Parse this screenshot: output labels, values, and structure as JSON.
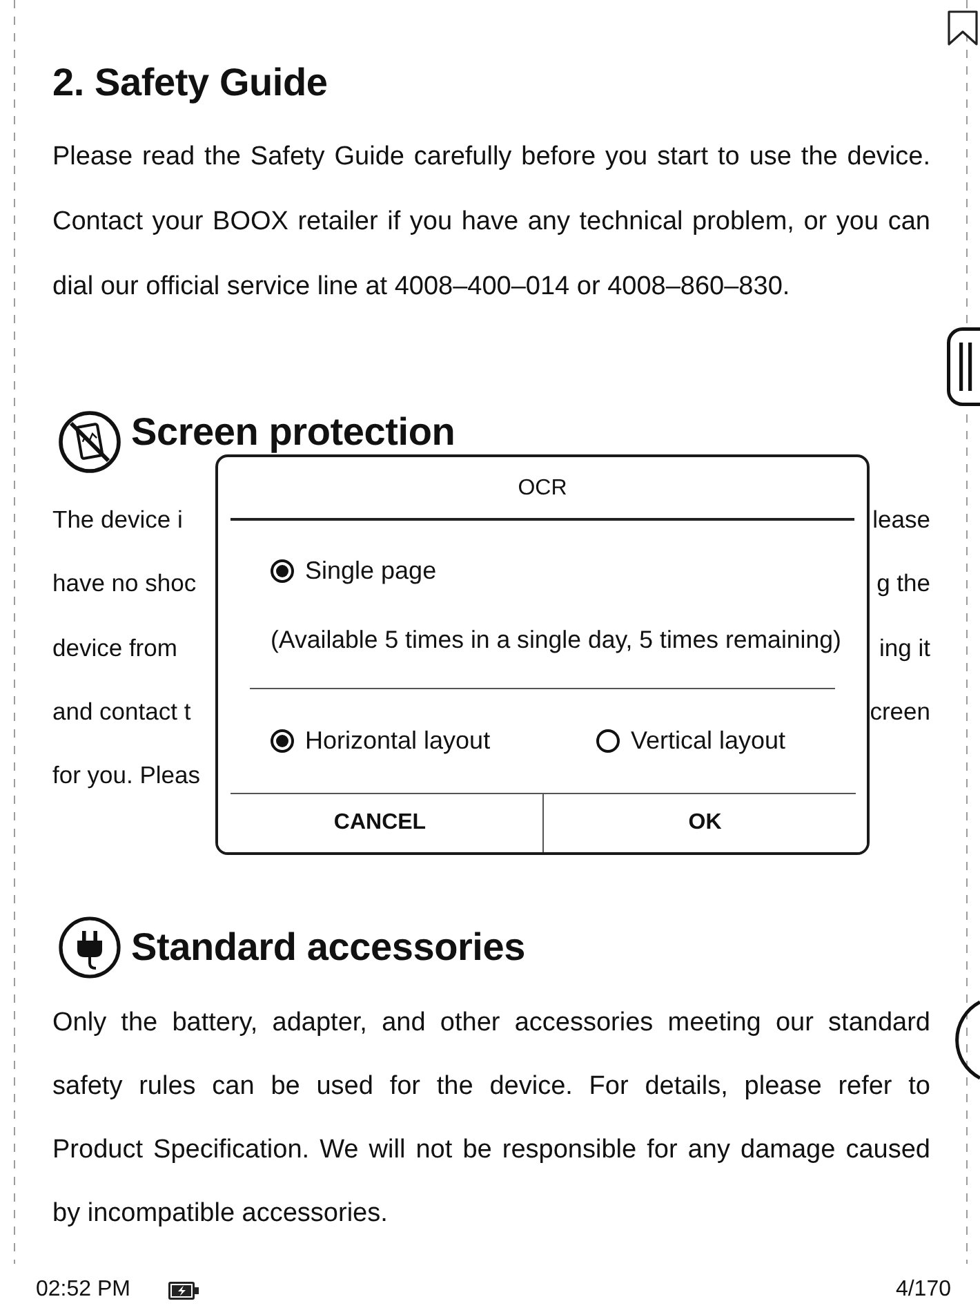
{
  "section": {
    "title": "2. Safety Guide",
    "paragraph": [
      "Please read the Safety Guide carefully before you start to use the device.",
      "Contact your BOOX retailer if you have any technical problem, or you can",
      "dial our official service line at 4008–400–014 or 4008–860–830."
    ]
  },
  "subsections": [
    {
      "heading": "Screen protection",
      "covered_lines": [
        {
          "left": "The device i",
          "right": "lease"
        },
        {
          "left": "have no shoc",
          "right": "g the"
        },
        {
          "left": "device from",
          "right": "ing it"
        },
        {
          "left": "and contact t",
          "right": "creen"
        },
        {
          "left": "for you. Pleas"
        }
      ]
    },
    {
      "heading": "Standard accessories",
      "paragraph": [
        "Only the battery, adapter, and other accessories meeting our standard",
        "safety rules can be used for the device. For details, please refer to",
        "Product Specification. We will not be responsible for any damage caused",
        "by incompatible accessories."
      ]
    }
  ],
  "dialog": {
    "title": "OCR",
    "scope": [
      {
        "label": "Single page",
        "selected": true
      }
    ],
    "note": "(Available 5 times in a single day, 5 times remaining)",
    "layouts": [
      {
        "label": "Horizontal layout",
        "selected": true
      },
      {
        "label": "Vertical layout",
        "selected": false
      }
    ],
    "buttons": [
      "CANCEL",
      "OK"
    ]
  },
  "status_bar": {
    "time": "02:52 PM",
    "page": "4/170"
  }
}
